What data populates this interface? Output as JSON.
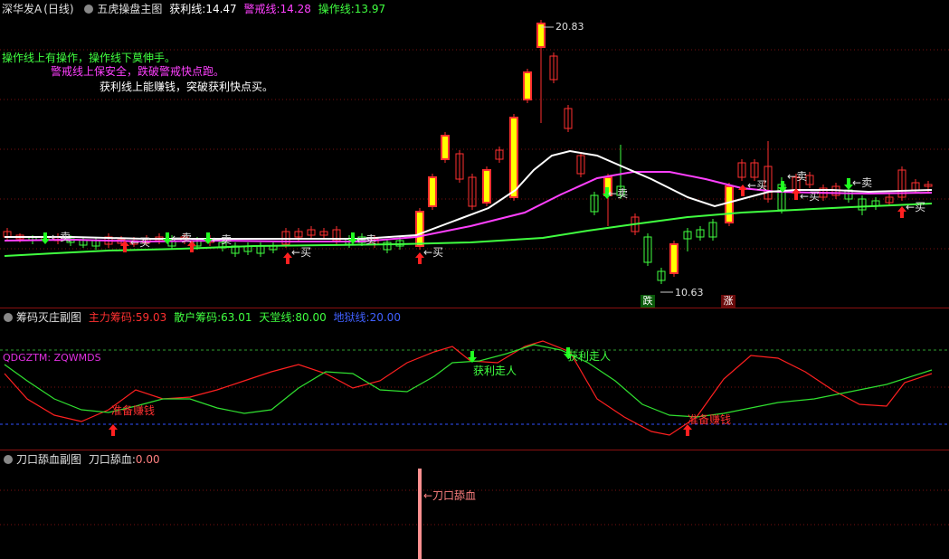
{
  "main": {
    "stock_name": "深华发A",
    "period": "(日线)",
    "indicator_name": "五虎操盘主图",
    "profit_label": "获利线:",
    "profit_value": "14.47",
    "warn_label": "警戒线:",
    "warn_value": "14.28",
    "op_label": "操作线:",
    "op_value": "13.97",
    "note1": "操作线上有操作，操作线下莫伸手。",
    "note2": "警戒线上保安全，跌破警戒快点跑。",
    "note3": "获利线上能赚钱，突破获利快点买。",
    "high_label": "20.83",
    "low_label": "10.63",
    "buy": "买",
    "sell": "卖",
    "die": "跌",
    "zhang": "涨",
    "colors": {
      "profit": "#ffffff",
      "warn": "#ff40ff",
      "op": "#40ff40",
      "up": "#ff3030",
      "down": "#40ff40",
      "bg": "#000000"
    }
  },
  "sub1": {
    "name": "筹码灭庄副图",
    "main_label": "主力筹码:",
    "main_value": "59.03",
    "retail_label": "散户筹码:",
    "retail_value": "63.01",
    "heaven_label": "天堂线:",
    "heaven_value": "80.00",
    "hell_label": "地狱线:",
    "hell_value": "20.00",
    "left_text": "QDGZTM: ZQWMDS",
    "prepare": "准备赚钱",
    "profit_go": "获利走人"
  },
  "sub2": {
    "name": "刀口舔血副图",
    "label": "刀口舔血:",
    "value": "0.00",
    "arrow_text": "←刀口舔血"
  }
}
